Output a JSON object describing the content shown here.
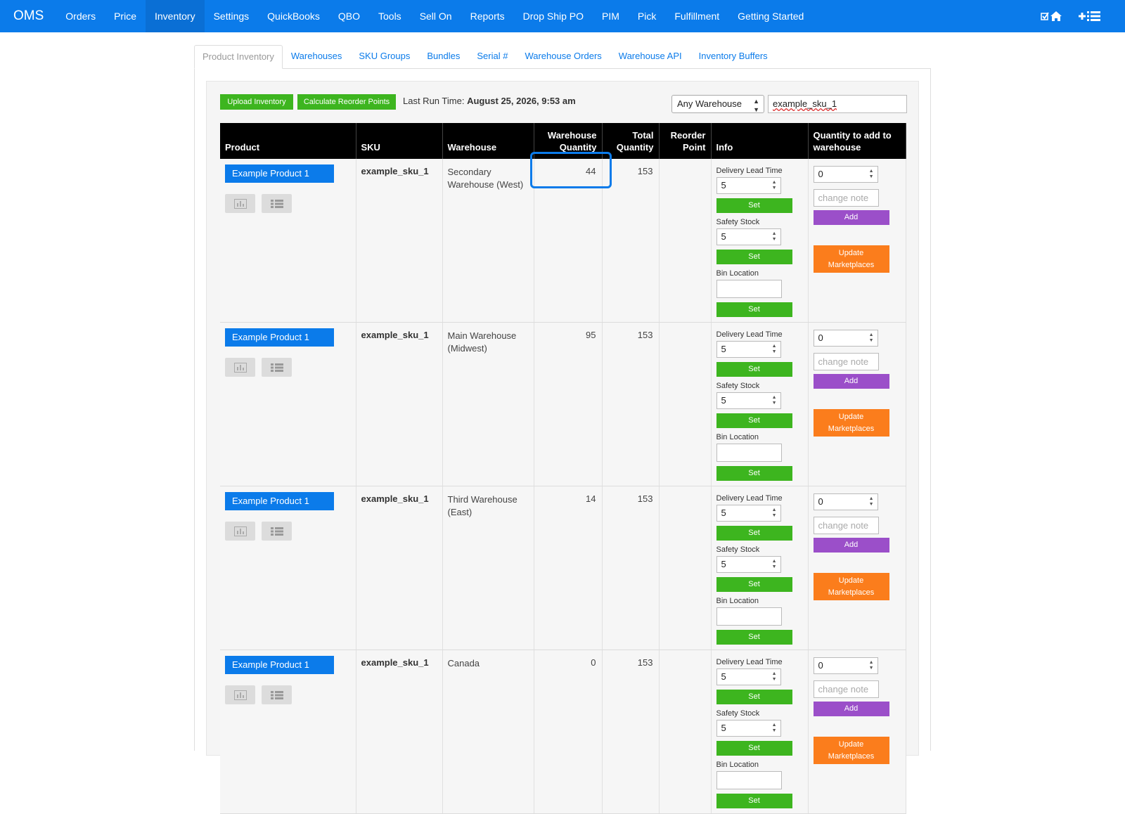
{
  "nav": {
    "brand": "OMS",
    "items": [
      "Orders",
      "Price",
      "Inventory",
      "Settings",
      "QuickBooks",
      "QBO",
      "Tools",
      "Sell On",
      "Reports",
      "Drop Ship PO",
      "PIM",
      "Pick",
      "Fulfillment",
      "Getting Started"
    ],
    "active": "Inventory"
  },
  "tabs": {
    "items": [
      "Product Inventory",
      "Warehouses",
      "SKU Groups",
      "Bundles",
      "Serial #",
      "Warehouse Orders",
      "Warehouse API",
      "Inventory Buffers"
    ],
    "active": "Product Inventory"
  },
  "toolbar": {
    "upload_label": "Upload Inventory",
    "calc_label": "Calculate Reorder Points",
    "last_run_label": "Last Run Time:",
    "last_run_value": "August 25, 2026, 9:53 am",
    "warehouse_filter": "Any Warehouse",
    "search_value": "example_sku_1"
  },
  "table": {
    "headers": {
      "product": "Product",
      "sku": "SKU",
      "warehouse": "Warehouse",
      "wh_qty_1": "Warehouse",
      "wh_qty_2": "Quantity",
      "total_1": "Total",
      "total_2": "Quantity",
      "reorder_1": "Reorder",
      "reorder_2": "Point",
      "info": "Info",
      "add_1": "Quantity to add to",
      "add_2": "warehouse"
    },
    "labels": {
      "lead_time": "Delivery Lead Time",
      "safety_stock": "Safety Stock",
      "bin_location": "Bin Location",
      "set": "Set",
      "note_placeholder": "change note",
      "add": "Add",
      "update_1": "Update",
      "update_2": "Marketplaces"
    },
    "rows": [
      {
        "product": "Example Product 1",
        "sku": "example_sku_1",
        "warehouse": "Secondary Warehouse (West)",
        "wh_qty": "44",
        "total": "153",
        "reorder": "",
        "lead_time": "5",
        "safety_stock": "5",
        "bin": "",
        "qty_add": "0"
      },
      {
        "product": "Example Product 1",
        "sku": "example_sku_1",
        "warehouse": "Main Warehouse (Midwest)",
        "wh_qty": "95",
        "total": "153",
        "reorder": "",
        "lead_time": "5",
        "safety_stock": "5",
        "bin": "",
        "qty_add": "0"
      },
      {
        "product": "Example Product 1",
        "sku": "example_sku_1",
        "warehouse": "Third Warehouse (East)",
        "wh_qty": "14",
        "total": "153",
        "reorder": "",
        "lead_time": "5",
        "safety_stock": "5",
        "bin": "",
        "qty_add": "0"
      },
      {
        "product": "Example Product 1",
        "sku": "example_sku_1",
        "warehouse": "Canada",
        "wh_qty": "0",
        "total": "153",
        "reorder": "",
        "lead_time": "5",
        "safety_stock": "5",
        "bin": "",
        "qty_add": "0"
      }
    ]
  },
  "colors": {
    "nav_bg": "#0b7bea",
    "green": "#3db51f",
    "purple": "#9b4fc9",
    "orange": "#fb7d1c",
    "highlight": "#0b7bea"
  }
}
